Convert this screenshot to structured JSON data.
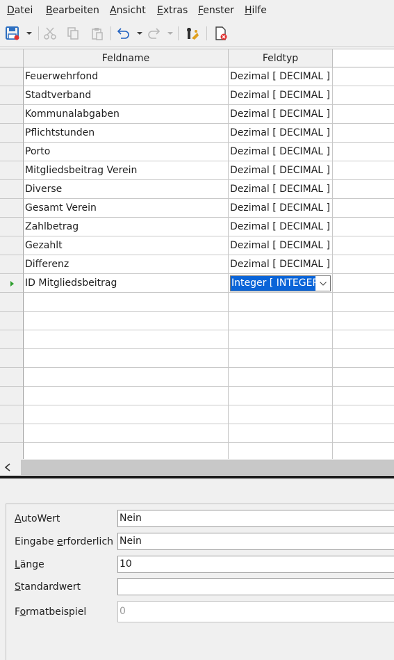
{
  "menu": [
    {
      "label": "Datei",
      "u": "D",
      "rest": "atei"
    },
    {
      "label": "Bearbeiten",
      "u": "B",
      "rest": "earbeiten"
    },
    {
      "label": "Ansicht",
      "u": "A",
      "rest": "nsicht"
    },
    {
      "label": "Extras",
      "u": "E",
      "rest": "xtras"
    },
    {
      "label": "Fenster",
      "u": "F",
      "rest": "enster"
    },
    {
      "label": "Hilfe",
      "u": "H",
      "rest": "ilfe"
    }
  ],
  "toolbar": {
    "icons": [
      "save-icon",
      "cut-icon",
      "copy-icon",
      "paste-icon",
      "undo-icon",
      "redo-icon",
      "primary-key-icon",
      "delete-icon"
    ],
    "colors": {
      "save": "#2d6fc1",
      "save_dot": "#e03030",
      "disabled": "#b8b8b8",
      "accent_blue": "#2060c0",
      "key": "#e0a020",
      "delete_red": "#e03030"
    }
  },
  "grid": {
    "headers": {
      "field_name": "Feldname",
      "field_type": "Feldtyp"
    },
    "rows": [
      {
        "name": "Feuerwehrfond",
        "type": "Dezimal [ DECIMAL ]"
      },
      {
        "name": "Stadtverband",
        "type": "Dezimal [ DECIMAL ]"
      },
      {
        "name": "Kommunalabgaben",
        "type": "Dezimal [ DECIMAL ]"
      },
      {
        "name": "Pflichtstunden",
        "type": "Dezimal [ DECIMAL ]"
      },
      {
        "name": "Porto",
        "type": "Dezimal [ DECIMAL ]"
      },
      {
        "name": "Mitgliedsbeitrag Verein",
        "type": "Dezimal [ DECIMAL ]"
      },
      {
        "name": "Diverse",
        "type": "Dezimal [ DECIMAL ]"
      },
      {
        "name": "Gesamt Verein",
        "type": "Dezimal [ DECIMAL ]"
      },
      {
        "name": "Zahlbetrag",
        "type": "Dezimal [ DECIMAL ]"
      },
      {
        "name": "Gezahlt",
        "type": "Dezimal [ DECIMAL ]"
      },
      {
        "name": "Differenz",
        "type": "Dezimal [ DECIMAL ]"
      }
    ],
    "current_row": {
      "name": "ID Mitgliedsbeitrag",
      "type": "Integer [ INTEGER ]"
    },
    "selection_color": "#0a64d8",
    "row_indicator_color": "#2e9e2e"
  },
  "properties": {
    "autowert": {
      "label": "AutoWert",
      "u": "A",
      "rest": "utoWert",
      "value": "Nein"
    },
    "eingabe": {
      "label": "Eingabe erforderlich",
      "pre": "Eingabe ",
      "u": "e",
      "rest": "rforderlich",
      "value": "Nein"
    },
    "laenge": {
      "label": "Länge",
      "u": "L",
      "rest": "änge",
      "value": "10"
    },
    "standardwert": {
      "label": "Standardwert",
      "u": "S",
      "rest": "tandardwert",
      "value": ""
    },
    "formatbeispiel": {
      "label": "Formatbeispiel",
      "pre": "F",
      "u": "o",
      "rest": "rmatbeispiel",
      "value": "0"
    }
  }
}
